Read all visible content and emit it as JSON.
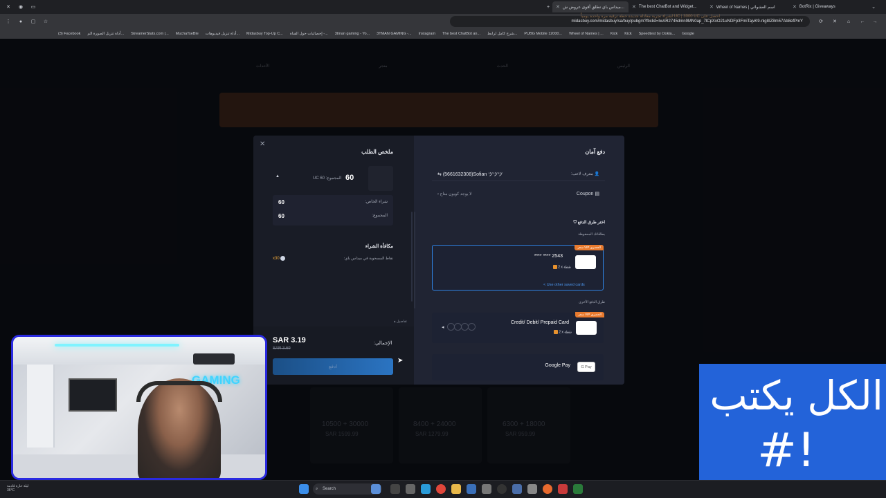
{
  "browser": {
    "tabs": [
      {
        "title": "ميداس باي تطلق أقوى عروض ش...",
        "active": true
      },
      {
        "title": "The best ChatBot and Widget...",
        "active": false
      },
      {
        "title": "Wheel of Names | اسم العشوائي",
        "active": false
      },
      {
        "title": "BotRix | Giveaways",
        "active": false
      }
    ],
    "url": "midasbuy.com/midasbuy/sa/buy/pubgm?fbclid=IwAR2745dmn9MN0ap_7lCpXxO21uNDFp3FmiTajvK9-nlg8IZ8m57Ab8efPmY",
    "bookmarks": [
      "(3) Facebook",
      "أداة تنزيل الصورة الم...",
      "StreamerStats.com |...",
      "MuchaTseBle",
      "أداة تنزيل فيديوهات...",
      "Midasbuy Top-Up C...",
      "إحصائيات حول القناة -...",
      "3tman gaming - Yo...",
      "3TMAN GAMING -...",
      "Instagram",
      "The best ChatBot an...",
      "شرح كامل لرابط...",
      "PUBG Mobile 12000...",
      "Wheel of Names | ...",
      "Kick",
      "Kick",
      "Speedtest by Ookla...",
      "Google"
    ]
  },
  "site": {
    "nav": [
      "الأحداث",
      "متجر",
      "الحدث",
      "الرئيس"
    ],
    "promo_text": "احصل على UC | 3000 UC لشراء تجربة معادلة جديدة خطة ترقية مرة واحدة يومياً",
    "bg_prices": [
      "SAR 1599.99",
      "SAR 1279.99",
      "SAR 959.99"
    ],
    "bg_packs": [
      "10500 + 30000",
      "8400 + 24000",
      "6300 + 18000"
    ]
  },
  "order_summary": {
    "title": "ملخص الطلب",
    "close_icon": "close-icon",
    "item_qty": "60",
    "item_total_label": "المجموع: 60 UC",
    "rows": [
      {
        "label": "شراء الخاص:",
        "value": "60"
      },
      {
        "label": "المجموع:",
        "value": "60"
      }
    ],
    "reward_title": "مكافأة الشراء",
    "reward_desc": "نقاط المسحوبة في ميداس باي:",
    "reward_value": "x30",
    "details_label": "تفاصيل",
    "total_label": "الإجمالي:",
    "price_now": "SAR 3.19",
    "price_old": "SAR 3.69",
    "pay_label": "ادفع"
  },
  "payment": {
    "title": "دفع آمان",
    "player_label": "معرف لاعب:",
    "player_name": "(5661632308)Sofian ツツツ",
    "coupon_label": "Coupon",
    "coupon_value": "لا يوجد كوبون متاح",
    "choose_method": "اختر طرق الدفع",
    "saved_cards_label": "بطاقاتك المحفوظة",
    "vip_badge": "سعر VIP الحصري",
    "saved_card_number": "**** **** 2543",
    "points_label": "2 x نقطة",
    "other_saved": "< Use other saved cards",
    "other_methods_label": "طرق الدفع الأخرى",
    "cc_label": "Credit/ Debit/ Prepaid Card",
    "gpay_label": "Google Pay",
    "gpay_logo": "G Pay"
  },
  "stream_overlay": {
    "line1": "الكل يكتب",
    "line2": "#!",
    "webcam_sign": "GAMING"
  },
  "taskbar": {
    "weather": "ليلة حارة قادمة",
    "temp": "36°C",
    "search_placeholder": "Search"
  },
  "colors": {
    "accent": "#2f83e4",
    "overlay_blue": "#2363d9",
    "vip_orange": "#e87a2e",
    "webcam_border": "#2a2ae0"
  }
}
